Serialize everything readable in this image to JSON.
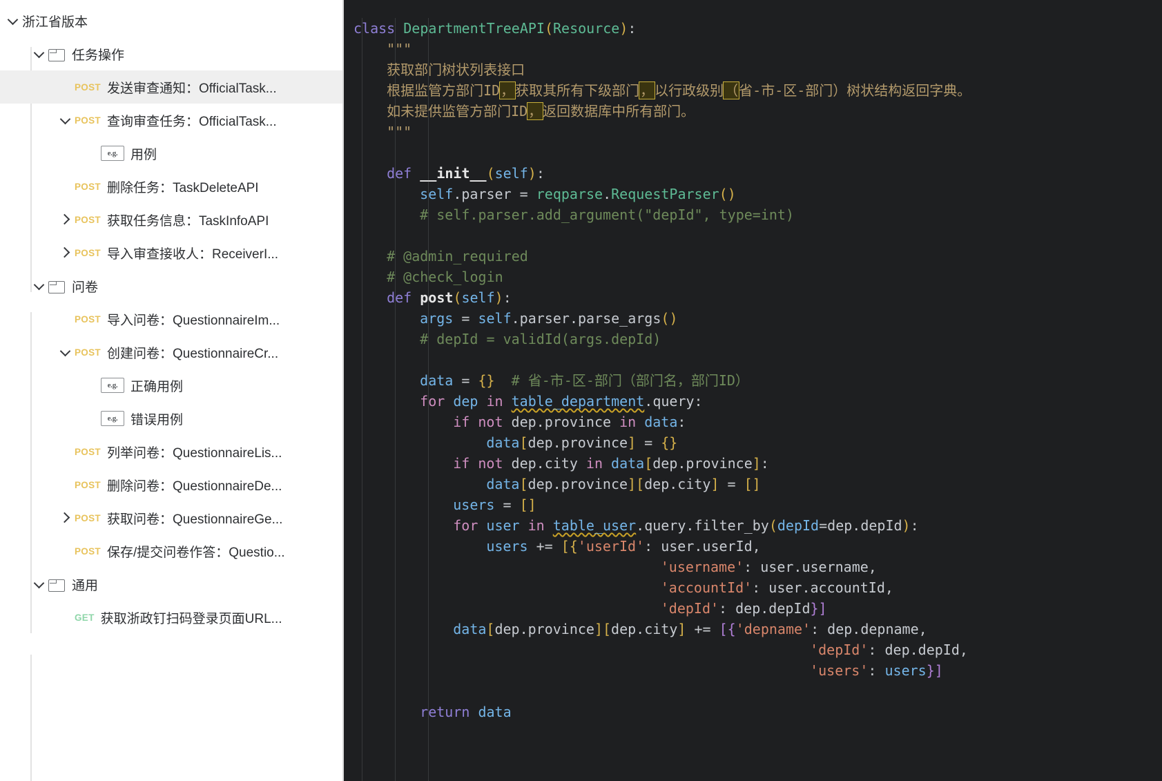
{
  "sidebar": {
    "items": [
      {
        "id": "zhejiang-version",
        "depth": 0,
        "twisty": "down",
        "icon": "none",
        "method": "",
        "label": "浙江省版本",
        "selected": false
      },
      {
        "id": "task-ops-folder",
        "depth": 1,
        "twisty": "down",
        "icon": "folder",
        "method": "",
        "label": "任务操作",
        "selected": false
      },
      {
        "id": "send-review-notice",
        "depth": 2,
        "twisty": "none",
        "icon": "none",
        "method": "POST",
        "label": "发送审查通知：OfficialTask...",
        "selected": true
      },
      {
        "id": "query-review-task",
        "depth": 2,
        "twisty": "down",
        "icon": "none",
        "method": "POST",
        "label": "查询审查任务：OfficialTask...",
        "selected": false
      },
      {
        "id": "example-case-1",
        "depth": 3,
        "twisty": "none",
        "icon": "eg",
        "method": "",
        "label": "用例",
        "selected": false
      },
      {
        "id": "delete-task",
        "depth": 2,
        "twisty": "none",
        "icon": "none",
        "method": "POST",
        "label": "删除任务：TaskDeleteAPI",
        "selected": false
      },
      {
        "id": "get-task-info",
        "depth": 2,
        "twisty": "right",
        "icon": "none",
        "method": "POST",
        "label": "获取任务信息：TaskInfoAPI",
        "selected": false
      },
      {
        "id": "import-receiver",
        "depth": 2,
        "twisty": "right",
        "icon": "none",
        "method": "POST",
        "label": "导入审查接收人：ReceiverI...",
        "selected": false
      },
      {
        "id": "questionnaire-folder",
        "depth": 1,
        "twisty": "down",
        "icon": "folder",
        "method": "",
        "label": "问卷",
        "selected": false
      },
      {
        "id": "import-questionnaire",
        "depth": 2,
        "twisty": "none",
        "icon": "none",
        "method": "POST",
        "label": "导入问卷：QuestionnaireIm...",
        "selected": false
      },
      {
        "id": "create-questionnaire",
        "depth": 2,
        "twisty": "down",
        "icon": "none",
        "method": "POST",
        "label": "创建问卷：QuestionnaireCr...",
        "selected": false
      },
      {
        "id": "correct-example",
        "depth": 3,
        "twisty": "none",
        "icon": "eg",
        "method": "",
        "label": "正确用例",
        "selected": false
      },
      {
        "id": "error-example",
        "depth": 3,
        "twisty": "none",
        "icon": "eg",
        "method": "",
        "label": "错误用例",
        "selected": false
      },
      {
        "id": "list-questionnaire",
        "depth": 2,
        "twisty": "none",
        "icon": "none",
        "method": "POST",
        "label": "列举问卷：QuestionnaireLis...",
        "selected": false
      },
      {
        "id": "delete-questionnaire",
        "depth": 2,
        "twisty": "none",
        "icon": "none",
        "method": "POST",
        "label": "删除问卷：QuestionnaireDe...",
        "selected": false
      },
      {
        "id": "get-questionnaire",
        "depth": 2,
        "twisty": "right",
        "icon": "none",
        "method": "POST",
        "label": "获取问卷：QuestionnaireGe...",
        "selected": false
      },
      {
        "id": "save-submit-answer",
        "depth": 2,
        "twisty": "none",
        "icon": "none",
        "method": "POST",
        "label": "保存/提交问卷作答：Questio...",
        "selected": false
      },
      {
        "id": "common-folder",
        "depth": 1,
        "twisty": "down",
        "icon": "folder",
        "method": "",
        "label": "通用",
        "selected": false
      },
      {
        "id": "get-zzd-login-url",
        "depth": 2,
        "twisty": "none",
        "icon": "none",
        "method": "GET",
        "label": "获取浙政钉扫码登录页面URL...",
        "selected": false
      }
    ],
    "eg_icon_text": "e.g."
  },
  "editor": {
    "language": "python",
    "background": "#1e1f21",
    "lines": [
      {
        "indent": 0,
        "tokens": [
          {
            "t": "class ",
            "c": "kw"
          },
          {
            "t": "DepartmentTreeAPI",
            "c": "cls"
          },
          {
            "t": "(",
            "c": "par"
          },
          {
            "t": "Resource",
            "c": "cls"
          },
          {
            "t": ")",
            "c": "par"
          },
          {
            "t": ":",
            "c": "op"
          }
        ]
      },
      {
        "indent": 1,
        "tokens": [
          {
            "t": "\"\"\"",
            "c": "doc"
          }
        ]
      },
      {
        "indent": 1,
        "tokens": [
          {
            "t": "获取部门树状列表接口",
            "c": "doc"
          }
        ]
      },
      {
        "indent": 1,
        "tokens": [
          {
            "t": "根据监管方部门ID",
            "c": "doc"
          },
          {
            "t": "，",
            "c": "doc",
            "warn": true
          },
          {
            "t": "获取其所有下级部门",
            "c": "doc"
          },
          {
            "t": "，",
            "c": "doc",
            "warn": true
          },
          {
            "t": "以行政级别",
            "c": "doc"
          },
          {
            "t": "（",
            "c": "doc",
            "warn": true
          },
          {
            "t": "省-市-区-部门）树状结构返回字典。",
            "c": "doc"
          }
        ]
      },
      {
        "indent": 1,
        "tokens": [
          {
            "t": "如未提供监管方部门ID",
            "c": "doc"
          },
          {
            "t": "，",
            "c": "doc",
            "warn": true
          },
          {
            "t": "返回数据库中所有部门。",
            "c": "doc"
          }
        ]
      },
      {
        "indent": 1,
        "tokens": [
          {
            "t": "\"\"\"",
            "c": "doc"
          }
        ]
      },
      {
        "indent": 0,
        "tokens": []
      },
      {
        "indent": 1,
        "tokens": [
          {
            "t": "def ",
            "c": "kw"
          },
          {
            "t": "__init__",
            "c": "fn"
          },
          {
            "t": "(",
            "c": "par"
          },
          {
            "t": "self",
            "c": "var"
          },
          {
            "t": ")",
            "c": "par"
          },
          {
            "t": ":",
            "c": "op"
          }
        ]
      },
      {
        "indent": 2,
        "tokens": [
          {
            "t": "self",
            "c": "var"
          },
          {
            "t": ".parser ",
            "c": "attr"
          },
          {
            "t": "= ",
            "c": "op"
          },
          {
            "t": "reqparse",
            "c": "cls"
          },
          {
            "t": ".",
            "c": "op"
          },
          {
            "t": "RequestParser",
            "c": "cls"
          },
          {
            "t": "(",
            "c": "par"
          },
          {
            "t": ")",
            "c": "par"
          }
        ]
      },
      {
        "indent": 2,
        "tokens": [
          {
            "t": "# self.parser.add_argument(\"depId\", type=int)",
            "c": "cmt"
          }
        ]
      },
      {
        "indent": 0,
        "tokens": []
      },
      {
        "indent": 1,
        "tokens": [
          {
            "t": "# @admin_required",
            "c": "cmt"
          }
        ]
      },
      {
        "indent": 1,
        "tokens": [
          {
            "t": "# @check_login",
            "c": "cmt"
          }
        ]
      },
      {
        "indent": 1,
        "tokens": [
          {
            "t": "def ",
            "c": "kw"
          },
          {
            "t": "post",
            "c": "fn"
          },
          {
            "t": "(",
            "c": "par"
          },
          {
            "t": "self",
            "c": "var"
          },
          {
            "t": ")",
            "c": "par"
          },
          {
            "t": ":",
            "c": "op"
          }
        ]
      },
      {
        "indent": 2,
        "tokens": [
          {
            "t": "args ",
            "c": "var"
          },
          {
            "t": "= ",
            "c": "op"
          },
          {
            "t": "self",
            "c": "var"
          },
          {
            "t": ".parser",
            "c": "attr"
          },
          {
            "t": ".parse_args",
            "c": "attr"
          },
          {
            "t": "(",
            "c": "par"
          },
          {
            "t": ")",
            "c": "par"
          }
        ]
      },
      {
        "indent": 2,
        "tokens": [
          {
            "t": "# depId = validId(args.depId)",
            "c": "cmt"
          }
        ]
      },
      {
        "indent": 0,
        "tokens": []
      },
      {
        "indent": 2,
        "tokens": [
          {
            "t": "data ",
            "c": "var"
          },
          {
            "t": "= ",
            "c": "op"
          },
          {
            "t": "{}",
            "c": "par"
          },
          {
            "t": "  # 省-市-区-部门（部门名，部门ID）",
            "c": "cmt"
          }
        ]
      },
      {
        "indent": 2,
        "tokens": [
          {
            "t": "for ",
            "c": "kw2"
          },
          {
            "t": "dep ",
            "c": "var"
          },
          {
            "t": "in ",
            "c": "kw2"
          },
          {
            "t": "table_department",
            "c": "var",
            "squig": true
          },
          {
            "t": ".query",
            "c": "attr"
          },
          {
            "t": ":",
            "c": "op"
          }
        ]
      },
      {
        "indent": 3,
        "tokens": [
          {
            "t": "if ",
            "c": "kw2"
          },
          {
            "t": "not ",
            "c": "kw2"
          },
          {
            "t": "dep",
            "c": "attr"
          },
          {
            "t": ".province ",
            "c": "attr"
          },
          {
            "t": "in ",
            "c": "kw2"
          },
          {
            "t": "data",
            "c": "var"
          },
          {
            "t": ":",
            "c": "op"
          }
        ]
      },
      {
        "indent": 4,
        "tokens": [
          {
            "t": "data",
            "c": "var"
          },
          {
            "t": "[",
            "c": "par"
          },
          {
            "t": "dep",
            "c": "attr"
          },
          {
            "t": ".province",
            "c": "attr"
          },
          {
            "t": "]",
            "c": "par"
          },
          {
            "t": " = ",
            "c": "op"
          },
          {
            "t": "{}",
            "c": "par"
          }
        ]
      },
      {
        "indent": 3,
        "tokens": [
          {
            "t": "if ",
            "c": "kw2"
          },
          {
            "t": "not ",
            "c": "kw2"
          },
          {
            "t": "dep",
            "c": "attr"
          },
          {
            "t": ".city ",
            "c": "attr"
          },
          {
            "t": "in ",
            "c": "kw2"
          },
          {
            "t": "data",
            "c": "var"
          },
          {
            "t": "[",
            "c": "par"
          },
          {
            "t": "dep",
            "c": "attr"
          },
          {
            "t": ".province",
            "c": "attr"
          },
          {
            "t": "]",
            "c": "par"
          },
          {
            "t": ":",
            "c": "op"
          }
        ]
      },
      {
        "indent": 4,
        "tokens": [
          {
            "t": "data",
            "c": "var"
          },
          {
            "t": "[",
            "c": "par"
          },
          {
            "t": "dep",
            "c": "attr"
          },
          {
            "t": ".province",
            "c": "attr"
          },
          {
            "t": "]",
            "c": "par"
          },
          {
            "t": "[",
            "c": "par"
          },
          {
            "t": "dep",
            "c": "attr"
          },
          {
            "t": ".city",
            "c": "attr"
          },
          {
            "t": "]",
            "c": "par"
          },
          {
            "t": " = ",
            "c": "op"
          },
          {
            "t": "[]",
            "c": "par"
          }
        ]
      },
      {
        "indent": 3,
        "tokens": [
          {
            "t": "users ",
            "c": "var"
          },
          {
            "t": "= ",
            "c": "op"
          },
          {
            "t": "[]",
            "c": "par"
          }
        ]
      },
      {
        "indent": 3,
        "tokens": [
          {
            "t": "for ",
            "c": "kw2"
          },
          {
            "t": "user ",
            "c": "var"
          },
          {
            "t": "in ",
            "c": "kw2"
          },
          {
            "t": "table_user",
            "c": "var",
            "squig": true
          },
          {
            "t": ".query",
            "c": "attr"
          },
          {
            "t": ".filter_by",
            "c": "attr"
          },
          {
            "t": "(",
            "c": "par"
          },
          {
            "t": "depId",
            "c": "var"
          },
          {
            "t": "=",
            "c": "op"
          },
          {
            "t": "dep",
            "c": "attr"
          },
          {
            "t": ".depId",
            "c": "attr"
          },
          {
            "t": ")",
            "c": "par"
          },
          {
            "t": ":",
            "c": "op"
          }
        ]
      },
      {
        "indent": 4,
        "tokens": [
          {
            "t": "users ",
            "c": "var"
          },
          {
            "t": "+= ",
            "c": "op"
          },
          {
            "t": "[{",
            "c": "par"
          },
          {
            "t": "'userId'",
            "c": "str"
          },
          {
            "t": ": ",
            "c": "op"
          },
          {
            "t": "user",
            "c": "attr"
          },
          {
            "t": ".userId",
            "c": "attr"
          },
          {
            "t": ",",
            "c": "op"
          }
        ]
      },
      {
        "indent": 0,
        "pad": 37,
        "tokens": [
          {
            "t": "'username'",
            "c": "str"
          },
          {
            "t": ": ",
            "c": "op"
          },
          {
            "t": "user",
            "c": "attr"
          },
          {
            "t": ".username",
            "c": "attr"
          },
          {
            "t": ",",
            "c": "op"
          }
        ]
      },
      {
        "indent": 0,
        "pad": 37,
        "tokens": [
          {
            "t": "'accountId'",
            "c": "str"
          },
          {
            "t": ": ",
            "c": "op"
          },
          {
            "t": "user",
            "c": "attr"
          },
          {
            "t": ".accountId",
            "c": "attr"
          },
          {
            "t": ",",
            "c": "op"
          }
        ]
      },
      {
        "indent": 0,
        "pad": 37,
        "tokens": [
          {
            "t": "'depId'",
            "c": "str"
          },
          {
            "t": ": ",
            "c": "op"
          },
          {
            "t": "dep",
            "c": "attr"
          },
          {
            "t": ".depId",
            "c": "attr"
          },
          {
            "t": "}]",
            "c": "brk2"
          }
        ]
      },
      {
        "indent": 3,
        "tokens": [
          {
            "t": "data",
            "c": "var"
          },
          {
            "t": "[",
            "c": "par"
          },
          {
            "t": "dep",
            "c": "attr"
          },
          {
            "t": ".province",
            "c": "attr"
          },
          {
            "t": "]",
            "c": "par"
          },
          {
            "t": "[",
            "c": "par"
          },
          {
            "t": "dep",
            "c": "attr"
          },
          {
            "t": ".city",
            "c": "attr"
          },
          {
            "t": "]",
            "c": "par"
          },
          {
            "t": " += ",
            "c": "op"
          },
          {
            "t": "[{",
            "c": "brk2"
          },
          {
            "t": "'depname'",
            "c": "str"
          },
          {
            "t": ": ",
            "c": "op"
          },
          {
            "t": "dep",
            "c": "attr"
          },
          {
            "t": ".depname",
            "c": "attr"
          },
          {
            "t": ",",
            "c": "op"
          }
        ]
      },
      {
        "indent": 0,
        "pad": 55,
        "tokens": [
          {
            "t": "'depId'",
            "c": "str"
          },
          {
            "t": ": ",
            "c": "op"
          },
          {
            "t": "dep",
            "c": "attr"
          },
          {
            "t": ".depId",
            "c": "attr"
          },
          {
            "t": ",",
            "c": "op"
          }
        ]
      },
      {
        "indent": 0,
        "pad": 55,
        "tokens": [
          {
            "t": "'users'",
            "c": "str"
          },
          {
            "t": ": ",
            "c": "op"
          },
          {
            "t": "users",
            "c": "var"
          },
          {
            "t": "}]",
            "c": "brk2"
          }
        ]
      },
      {
        "indent": 0,
        "tokens": []
      },
      {
        "indent": 2,
        "tokens": [
          {
            "t": "return ",
            "c": "kw"
          },
          {
            "t": "data",
            "c": "var"
          }
        ]
      }
    ]
  }
}
